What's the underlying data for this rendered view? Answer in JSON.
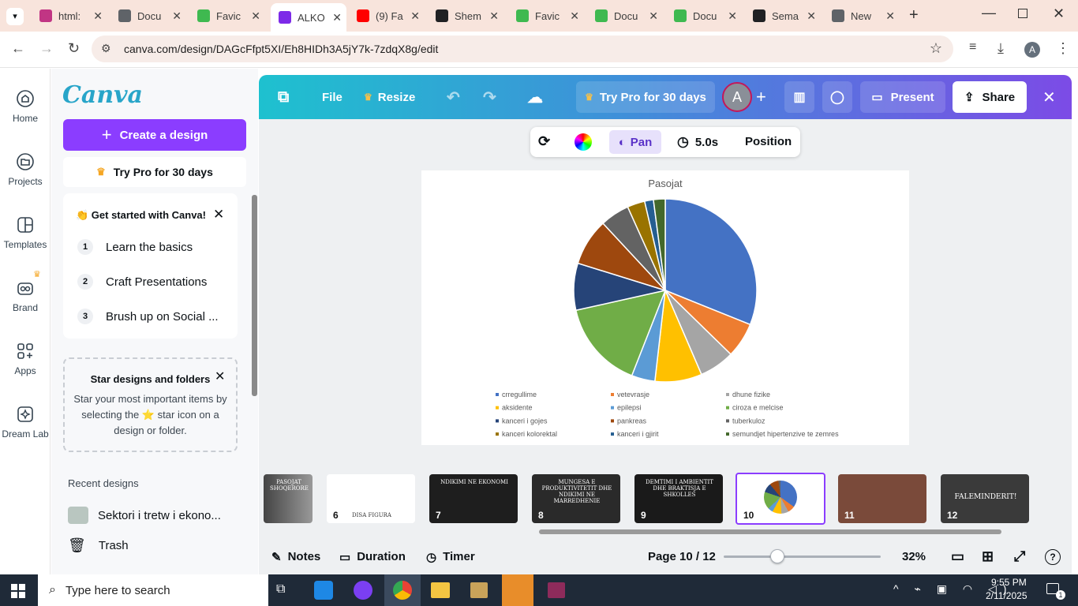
{
  "browser": {
    "tabs": [
      {
        "title": "html:",
        "color": "#c13584"
      },
      {
        "title": "Docu",
        "color": "#5f6368"
      },
      {
        "title": "Favic",
        "color": "#3fb950"
      },
      {
        "title": "ALKO",
        "color": "#7d2ae8",
        "active": true
      },
      {
        "title": "(9) Fa",
        "color": "#ff0000"
      },
      {
        "title": "Shem",
        "color": "#202124"
      },
      {
        "title": "Favic",
        "color": "#3fb950"
      },
      {
        "title": "Docu",
        "color": "#3fb950"
      },
      {
        "title": "Docu",
        "color": "#3fb950"
      },
      {
        "title": "Sema",
        "color": "#202124"
      },
      {
        "title": "New",
        "color": "#5f6368"
      }
    ],
    "url": "canva.com/design/DAGcFfpt5XI/Eh8HIDh3A5jY7k-7zdqX8g/edit",
    "profile_initial": "A"
  },
  "rail": {
    "items": [
      {
        "label": "Home",
        "icon": "home-icon"
      },
      {
        "label": "Projects",
        "icon": "folder-icon"
      },
      {
        "label": "Templates",
        "icon": "templates-icon"
      },
      {
        "label": "Brand",
        "icon": "brand-icon"
      },
      {
        "label": "Apps",
        "icon": "apps-icon"
      },
      {
        "label": "Dream Lab",
        "icon": "dreamlab-icon"
      }
    ]
  },
  "panel": {
    "logo": "Canva",
    "create_label": "Create a design",
    "try_pro_label": "Try Pro for 30 days",
    "get_started": {
      "title": "👏 Get started with Canva!",
      "steps": [
        {
          "num": "1",
          "label": "Learn the basics"
        },
        {
          "num": "2",
          "label": "Craft Presentations"
        },
        {
          "num": "3",
          "label": "Brush up on Social ..."
        }
      ]
    },
    "star_box": {
      "title": "Star designs and folders",
      "body": "Star your most important items by selecting the ⭐ star icon on a design or folder."
    },
    "recent_title": "Recent designs",
    "recent_item": "Sektori i tretw i ekono...",
    "trash_label": "Trash"
  },
  "editor": {
    "topbar": {
      "file": "File",
      "resize": "Resize",
      "try_pro": "Try Pro for 30 days",
      "avatar": "A",
      "present": "Present",
      "share": "Share"
    },
    "context": {
      "pan": "Pan",
      "duration": "5.0s",
      "position": "Position"
    },
    "bottom": {
      "notes": "Notes",
      "duration": "Duration",
      "timer": "Timer",
      "page": "Page 10 / 12",
      "zoom": "32%",
      "zoom_fraction": 0.34
    },
    "thumbnails": [
      {
        "num": "",
        "title": "PASOJAT SHOQERORE",
        "bg": "#555555"
      },
      {
        "num": "6",
        "title": "DISA FIGURA",
        "bg": "#ffffff"
      },
      {
        "num": "7",
        "title": "NDIKIMI NE EKONOMI",
        "bg": "#1e1e1e"
      },
      {
        "num": "8",
        "title": "MUNGESA E PRODUKTIVITETIT DHE NDIKIMI NE MARREDHENIE",
        "bg": "#2a2a2a"
      },
      {
        "num": "9",
        "title": "DEMTIMI I AMBIENTIT DHE BRAKTISJA E SHKOLLES",
        "bg": "#1a1a1a"
      },
      {
        "num": "10",
        "title": "",
        "bg": "#ffffff"
      },
      {
        "num": "11",
        "title": "",
        "bg": "#7a4a3a"
      },
      {
        "num": "12",
        "title": "FALEMINDERIT!",
        "bg": "#3a3a3a"
      }
    ]
  },
  "chart_data": {
    "type": "pie",
    "title": "Pasojat",
    "categories": [
      "crregullime",
      "vetevrasje",
      "dhune fizike",
      "aksidente",
      "epilepsi",
      "ciroza e melcise",
      "kanceri i gojes",
      "pankreas",
      "tuberkuloz",
      "kanceri kolorektal",
      "kanceri i gjirit",
      "semundjet hipertenzive te zemres"
    ],
    "values": [
      30,
      6,
      6,
      8,
      4,
      15,
      8,
      8,
      5,
      3,
      1.5,
      2
    ],
    "colors": [
      "#4472c4",
      "#ed7d31",
      "#a5a5a5",
      "#ffc000",
      "#5b9bd5",
      "#70ad47",
      "#264478",
      "#9e480e",
      "#636363",
      "#997300",
      "#255e91",
      "#43682b"
    ],
    "legend": "bottom"
  },
  "taskbar": {
    "search_placeholder": "Type here to search",
    "time": "9:55 PM",
    "date": "2/11/2025",
    "notif_count": "1"
  }
}
